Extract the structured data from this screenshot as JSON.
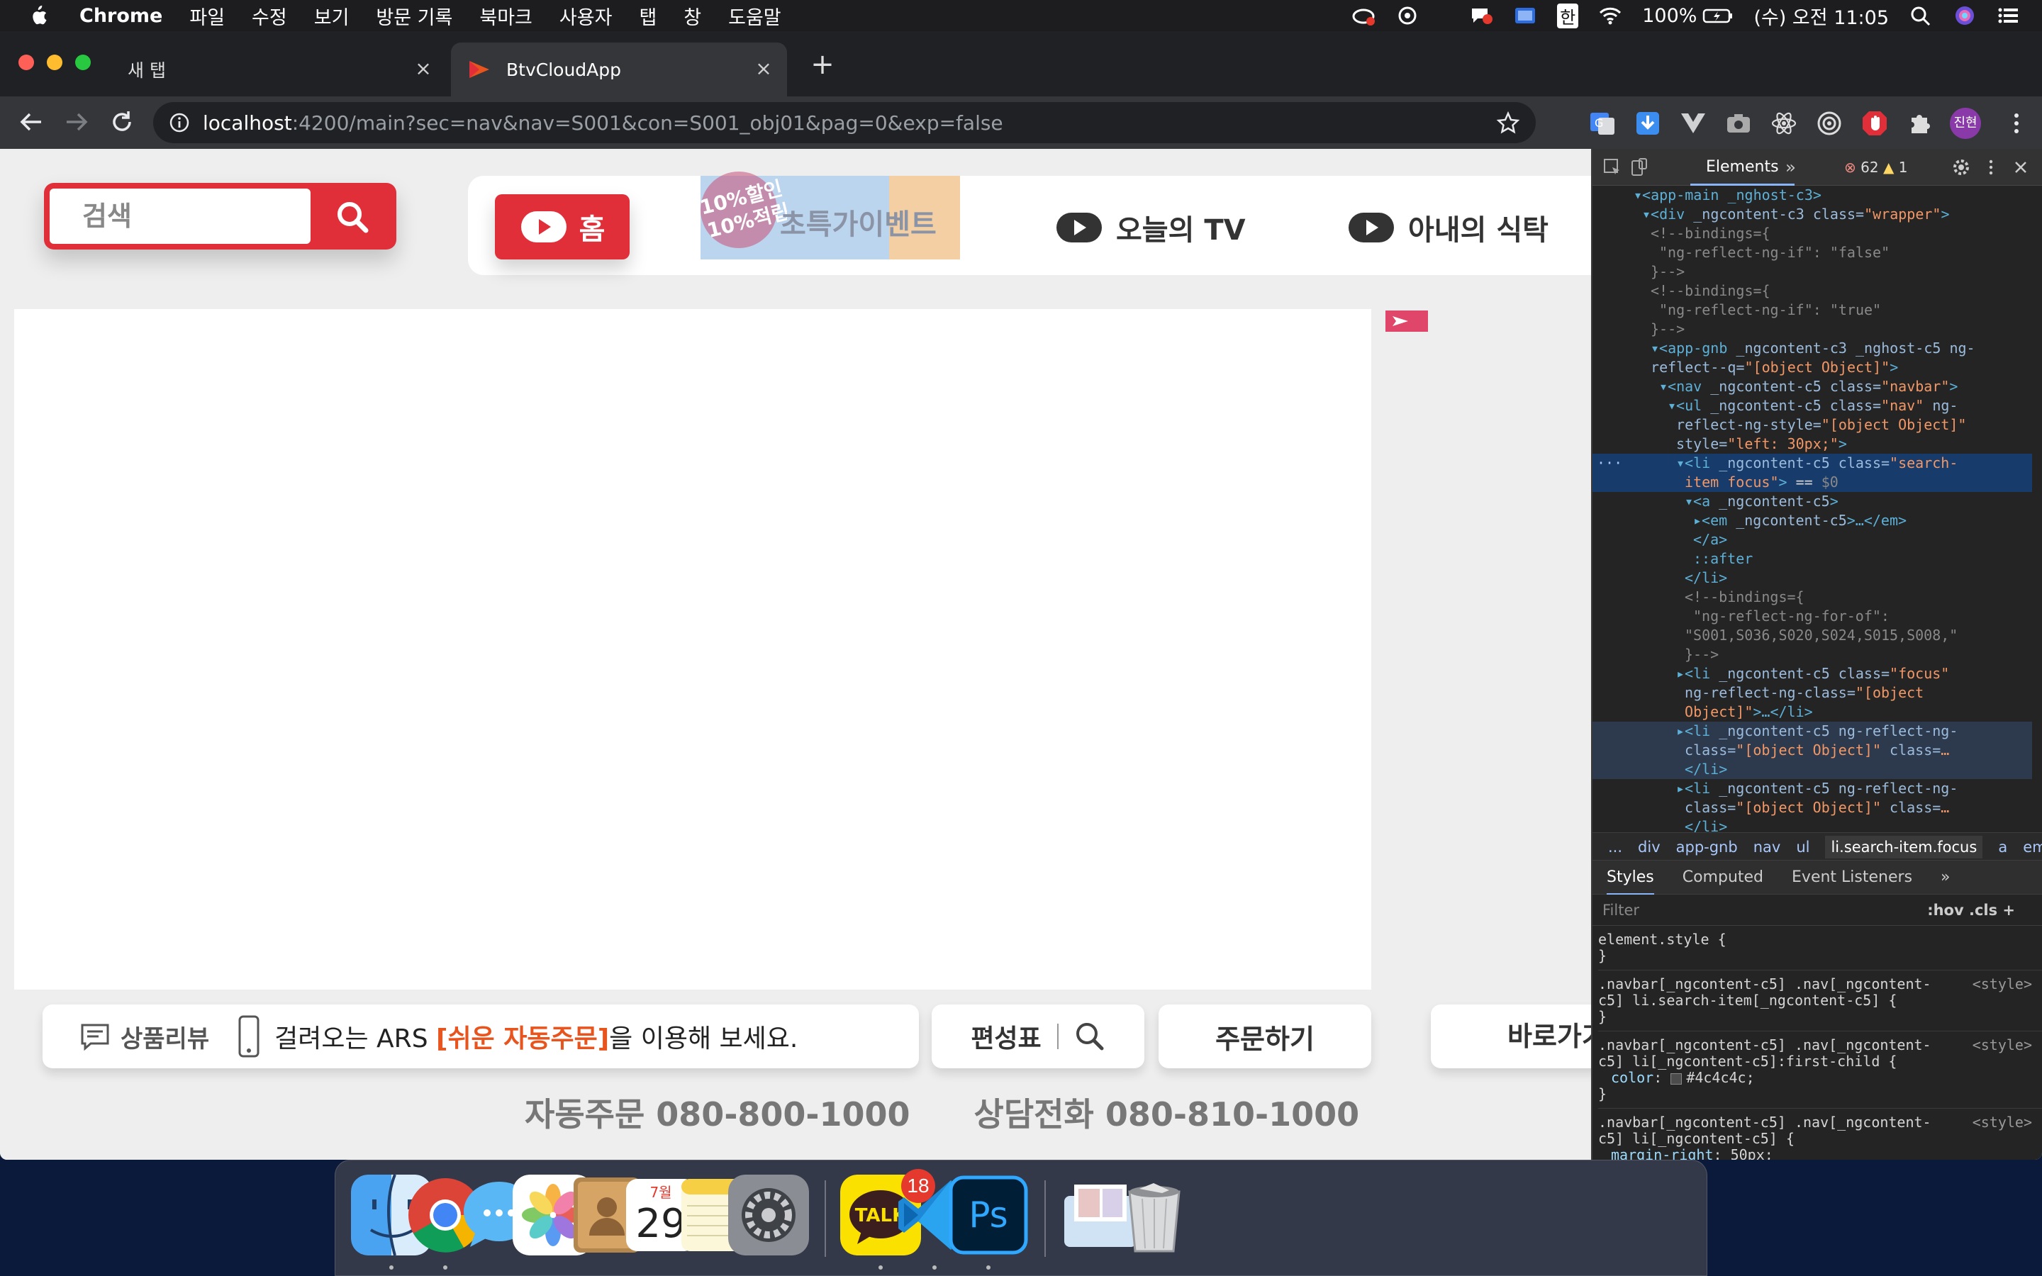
{
  "menubar": {
    "app_name": "Chrome",
    "menus": [
      "파일",
      "수정",
      "보기",
      "방문 기록",
      "북마크",
      "사용자",
      "탭",
      "창",
      "도움말"
    ],
    "ime": "한",
    "battery": "100%",
    "clock": "(수) 오전 11:05"
  },
  "browser": {
    "tabs": [
      {
        "title": "새 탭"
      },
      {
        "title": "BtvCloudApp"
      }
    ],
    "url_host": "localhost",
    "url_path": ":4200/main?sec=nav&nav=S001&con=S001_obj01&pag=0&exp=false",
    "profile_initials": "진현"
  },
  "page": {
    "search_label": "검색",
    "home_label": "홈",
    "event_stamp_line1": "10%할인",
    "event_stamp_line2": "10%적립",
    "event_label": "초특가이벤트",
    "gnb_items": [
      "오늘의 TV",
      "아내의 식탁"
    ],
    "review_label": "상품리뷰",
    "ars_text_before": "걸려오는 ARS ",
    "ars_highlight": "[쉬운 자동주문]",
    "ars_text_after": "을 이용해 보세요.",
    "schedule_label": "편성표",
    "order_label": "주문하기",
    "shortcut_label": "바로가기",
    "auto_order_phone": "자동주문 080-800-1000",
    "consult_phone": "상담전화 080-810-1000"
  },
  "devtools": {
    "panel_tab": "Elements",
    "error_count": "62",
    "warning_count": "1",
    "tree_lines": [
      {
        "indent": 4,
        "html": "<span class='tg'>▾&lt;app-main _nghost-c3&gt;</span>"
      },
      {
        "indent": 5,
        "html": "<span class='tg'>▾&lt;div</span> <span class='at'>_ngcontent-c3 class=</span><span class='av'>\"wrapper\"</span><span class='tg'>&gt;</span>"
      },
      {
        "indent": 6,
        "html": "<span class='cm'>&lt;!--bindings={</span>"
      },
      {
        "indent": 7,
        "html": "<span class='cm'>\"ng-reflect-ng-if\": \"false\"</span>"
      },
      {
        "indent": 6,
        "html": "<span class='cm'>}--&gt;</span>"
      },
      {
        "indent": 6,
        "html": "<span class='cm'>&lt;!--bindings={</span>"
      },
      {
        "indent": 7,
        "html": "<span class='cm'>\"ng-reflect-ng-if\": \"true\"</span>"
      },
      {
        "indent": 6,
        "html": "<span class='cm'>}--&gt;</span>"
      },
      {
        "indent": 6,
        "html": "<span class='tg'>▾&lt;app-gnb</span> <span class='at'>_ngcontent-c3 _nghost-c5 ng-</span>"
      },
      {
        "indent": 5,
        "html": " <span class='at'>reflect--q=</span><span class='av'>\"[object Object]\"</span><span class='tg'>&gt;</span>"
      },
      {
        "indent": 7,
        "html": "<span class='tg'>▾&lt;nav</span> <span class='at'>_ngcontent-c5 class=</span><span class='av'>\"navbar\"</span><span class='tg'>&gt;</span>"
      },
      {
        "indent": 8,
        "html": "<span class='tg'>▾&lt;ul</span> <span class='at'>_ngcontent-c5 class=</span><span class='av'>\"nav\"</span> <span class='at'>ng-</span>"
      },
      {
        "indent": 8,
        "html": " <span class='at'>reflect-ng-style=</span><span class='av'>\"[object Object]\"</span>"
      },
      {
        "indent": 8,
        "html": " <span class='at'>style=</span><span class='av'>\"left: 30px;\"</span><span class='tg'>&gt;</span>"
      },
      {
        "indent": 9,
        "sel": true,
        "html": "<span class='tg'>▾&lt;li</span> <span class='at'>_ngcontent-c5 class=</span><span class='av'>\"search-</span>"
      },
      {
        "indent": 9,
        "sel": true,
        "html": " <span class='av'>item focus\"</span><span class='tg'>&gt;</span> == <span class='cm'>$0</span>"
      },
      {
        "indent": 10,
        "html": "<span class='tg'>▾&lt;a</span> <span class='at'>_ngcontent-c5</span><span class='tg'>&gt;</span>"
      },
      {
        "indent": 11,
        "html": "<span class='tg'>▸&lt;em</span> <span class='at'>_ngcontent-c5</span><span class='tg'>&gt;…&lt;/em&gt;</span>"
      },
      {
        "indent": 11,
        "html": "<span class='tg'>&lt;/a&gt;</span>"
      },
      {
        "indent": 11,
        "html": "<span class='tg'>::after</span>"
      },
      {
        "indent": 10,
        "html": "<span class='tg'>&lt;/li&gt;</span>"
      },
      {
        "indent": 10,
        "html": "<span class='cm'>&lt;!--bindings={</span>"
      },
      {
        "indent": 11,
        "html": "<span class='cm'>\"ng-reflect-ng-for-of\":</span>"
      },
      {
        "indent": 10,
        "html": "<span class='cm'>\"S001,S036,S020,S024,S015,S008,\"</span>"
      },
      {
        "indent": 10,
        "html": "<span class='cm'>}--&gt;</span>"
      },
      {
        "indent": 9,
        "html": "<span class='tg'>▸&lt;li</span> <span class='at'>_ngcontent-c5 class=</span><span class='av'>\"focus\"</span>"
      },
      {
        "indent": 9,
        "html": " <span class='at'>ng-reflect-ng-class=</span><span class='av'>\"[object</span>"
      },
      {
        "indent": 9,
        "html": " <span class='av'>Object]\"</span><span class='tg'>&gt;…&lt;/li&gt;</span>"
      },
      {
        "indent": 9,
        "hov": true,
        "html": "<span class='tg'>▸&lt;li</span> <span class='at'>_ngcontent-c5 ng-reflect-ng-</span>"
      },
      {
        "indent": 9,
        "hov": true,
        "html": " <span class='at'>class=</span><span class='av'>\"[object Object]\"</span> <span class='at'>class=</span><span class='av'>…</span>"
      },
      {
        "indent": 9,
        "hov": true,
        "html": " <span class='tg'>&lt;/li&gt;</span>"
      },
      {
        "indent": 9,
        "html": "<span class='tg'>▸&lt;li</span> <span class='at'>_ngcontent-c5 ng-reflect-ng-</span>"
      },
      {
        "indent": 9,
        "html": " <span class='at'>class=</span><span class='av'>\"[object Object]\"</span> <span class='at'>class=</span><span class='av'>…</span>"
      },
      {
        "indent": 9,
        "html": " <span class='tg'>&lt;/li&gt;</span>"
      },
      {
        "indent": 9,
        "html": "<span class='tg'>▸&lt;li</span> <span class='at'>_ngcontent-c5 ng-reflect-ng-</span>"
      }
    ],
    "breadcrumbs": [
      "...",
      "div",
      "app-gnb",
      "nav",
      "ul",
      "li.search-item.focus",
      "a",
      "em"
    ],
    "style_tabs": [
      "Styles",
      "Computed",
      "Event Listeners",
      "»"
    ],
    "filter_placeholder": "Filter",
    "filter_buttons": ":hov  .cls  +",
    "style_rules": [
      {
        "selector": "element.style {",
        "body": "",
        "close": "}",
        "src": ""
      },
      {
        "selector": ".navbar[_ngcontent-c5] .nav[_ngcontent-\nc5] li.search-item[_ngcontent-c5] {",
        "body": "",
        "close": "}",
        "src": "<style>"
      },
      {
        "selector": ".navbar[_ngcontent-c5] .nav[_ngcontent-\nc5] li[_ngcontent-c5]:first-child {",
        "body": "color: #4c4c4c;",
        "close": "}",
        "src": "<style>"
      },
      {
        "selector": ".navbar[_ngcontent-c5] .nav[_ngcontent-\nc5] li[_ngcontent-c5] {",
        "body": "margin-right: 50px;",
        "close": "",
        "src": "<style>"
      }
    ]
  },
  "dock": {
    "calendar_month": "7월",
    "calendar_day": "29",
    "kakao_label": "TALK",
    "kakao_badge": "18",
    "ps_label": "Ps"
  },
  "colors": {
    "brand_red": "#e02f38",
    "highlight_orange": "#e8541e",
    "devtools_selected": "#173b6a"
  }
}
